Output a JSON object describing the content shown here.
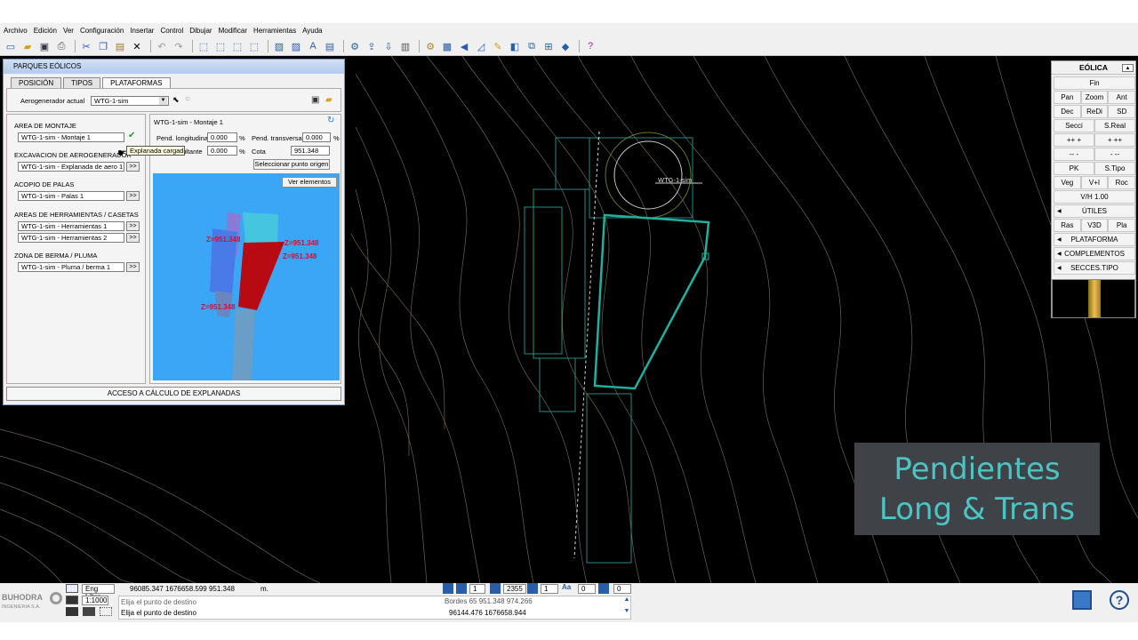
{
  "menu": [
    "Archivo",
    "Edición",
    "Ver",
    "Configuración",
    "Insertar",
    "Control",
    "Dibujar",
    "Modificar",
    "Herramientas",
    "Ayuda"
  ],
  "panel": {
    "title": "PARQUES EÓLICOS",
    "tabs": [
      "POSICIÓN",
      "TIPOS",
      "PLATAFORMAS"
    ],
    "aero_label": "Aerogenerador actual",
    "aero_value": "WTG-1-sim",
    "area_montaje": "AREA DE MONTAJE",
    "montaje_value": "WTG-1-sim - Montaje 1",
    "excavacion": "EXCAVACION DE AEROGENERADOR",
    "excavacion_value": "WTG-1-sim - Explanada de aero 1",
    "acopio": "ACOPIO DE PALAS",
    "acopio_value": "WTG-1-sim - Palas 1",
    "areas_herr": "AREAS DE HERRAMIENTAS / CASETAS",
    "herr1": "WTG-1-sim - Herramientas 1",
    "herr2": "WTG-1-sim - Herramientas 2",
    "zona_berma": "ZONA DE BERMA / PLUMA",
    "berma_value": "WTG-1-sim - Pluma / berma 1",
    "detail_title": "WTG-1-sim - Montaje 1",
    "pend_long": "Pend. longitudinal",
    "pend_long_val": "0.000",
    "pend_trans": "Pend. transversal",
    "pend_trans_val": "0.000",
    "pend_res": "Pend. resultante",
    "pend_res_short": "ultante",
    "pend_res_val": "0.000",
    "cota": "Cota",
    "cota_val": "951.348",
    "pct": "%",
    "sel_punto": "Seleccionar punto origen",
    "ver_elementos": "Ver elementos",
    "tooltip": "Explanada cargada",
    "acceso": "ACCESO A CÁLCULO DE EXPLANADAS",
    "more": ">>",
    "z_labels": [
      "Z=951.348",
      "Z=951.348",
      "Z=951.348",
      "Z=951.348"
    ]
  },
  "canvas": {
    "turbine_label": "WTG-1-sim"
  },
  "eolica": {
    "title": "EÓLICA",
    "fin": "Fin",
    "row1": [
      "Pan",
      "Zoom",
      "Ant"
    ],
    "row2": [
      "Dec",
      "ReDi",
      "SD"
    ],
    "row3": [
      "Secci",
      "S.Real"
    ],
    "row4": [
      "++ +",
      "+ ++"
    ],
    "row5": [
      "-- -",
      "- --"
    ],
    "row6": [
      "PK",
      "S.Tipo"
    ],
    "row7": [
      "Veg",
      "V+I",
      "Roc"
    ],
    "vh": "V/H 1.00",
    "utiles": "ÚTILES",
    "row8": [
      "Ras",
      "V3D",
      "Pla"
    ],
    "plataforma": "PLATAFORMA",
    "complementos": "COMPLEMENTOS",
    "secces": "SECCES.TIPO"
  },
  "overlay": {
    "line1": "Pendientes",
    "line2": "Long & Trans"
  },
  "status": {
    "logo": "BUHODRA",
    "logo_sub": "INGENIERIA S.A.",
    "mode": "Eng Libre",
    "coords": "96085.347  1676658.599  951.348",
    "unit": "m.",
    "scale": "1:1000",
    "prompt1": "Elija el punto de destino",
    "prompt2": "Elija el punto de destino",
    "n1": "1",
    "n2": "2355",
    "n3": "1",
    "n4": "0",
    "n5": "0",
    "bordes": "Bordes 65 951.348 974.266",
    "dest": "96144.476  1676658.944"
  }
}
